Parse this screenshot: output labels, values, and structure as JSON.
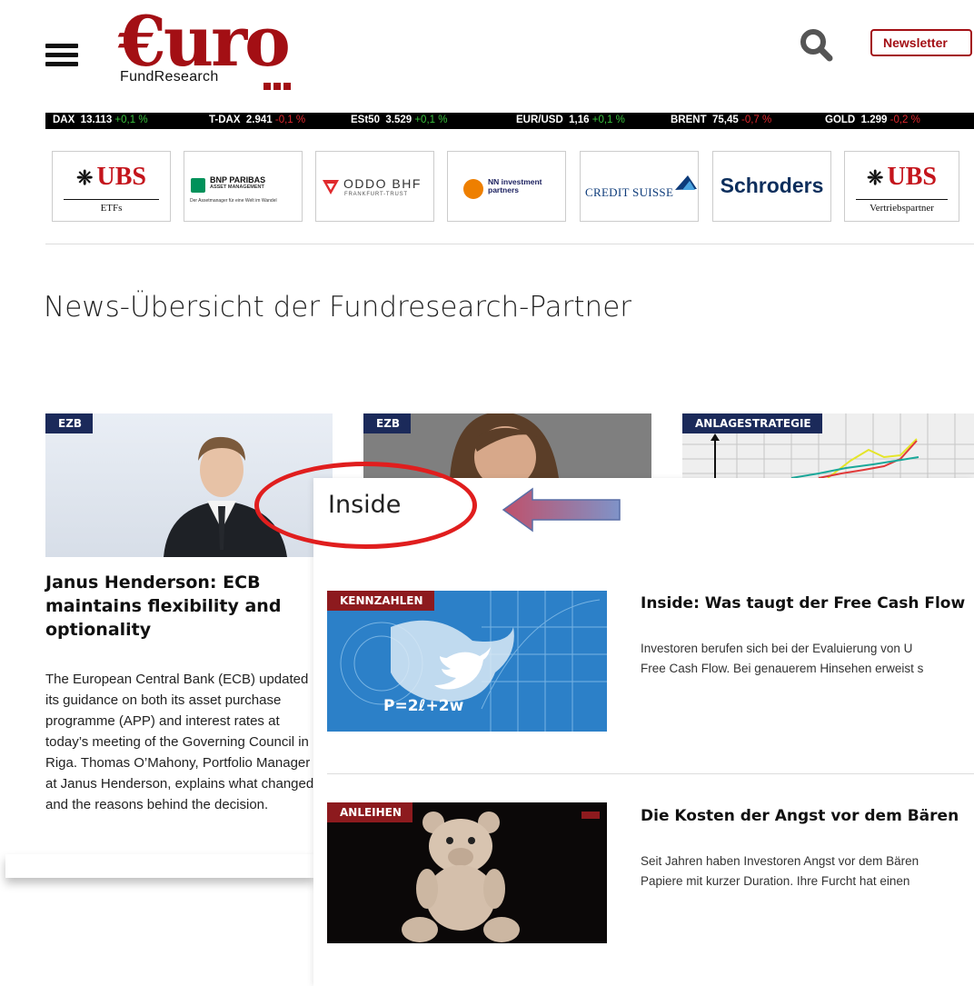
{
  "header": {
    "logo_text": "€uro",
    "logo_sub": "FundResearch",
    "newsletter_label": "Newsletter",
    "menu_icon": "hamburger-menu-icon",
    "search_icon": "search-icon"
  },
  "ticker": [
    {
      "name": "DAX",
      "value": "13.113",
      "change": "+0,1 %",
      "direction": "up"
    },
    {
      "name": "T-DAX",
      "value": "2.941",
      "change": "-0,1 %",
      "direction": "down"
    },
    {
      "name": "ESt50",
      "value": "3.529",
      "change": "+0,1 %",
      "direction": "up"
    },
    {
      "name": "EUR/USD",
      "value": "1,16",
      "change": "+0,1 %",
      "direction": "up"
    },
    {
      "name": "BRENT",
      "value": "75,45",
      "change": "-0,7 %",
      "direction": "down"
    },
    {
      "name": "GOLD",
      "value": "1.299",
      "change": "-0,2 %",
      "direction": "down"
    }
  ],
  "partners": [
    {
      "name": "UBS",
      "sub": "ETFs"
    },
    {
      "name": "BNP PARIBAS",
      "line2": "ASSET MANAGEMENT",
      "sub": "Der Assetmanager für eine Welt im Wandel"
    },
    {
      "name": "ODDO BHF",
      "sub": "FRANKFURT-TRUST"
    },
    {
      "name": "NN investment",
      "line2": "partners"
    },
    {
      "name": "CREDIT SUISSE"
    },
    {
      "name": "Schroders"
    },
    {
      "name": "UBS",
      "sub": "Vertriebspartner"
    }
  ],
  "page_title": "News-Übersicht der Fundresearch-Partner",
  "cards": [
    {
      "tag": "EZB"
    },
    {
      "tag": "EZB"
    },
    {
      "tag": "ANLAGESTRATEGIE"
    }
  ],
  "main_article": {
    "title": "Janus Henderson: ECB maintains flexibility and optionality",
    "text": "The European Central Bank (ECB) updated its guidance on both its asset purchase programme (APP) and interest rates at today’s meeting of the Governing Council in Riga. Thomas O’Mahony, Portfolio Manager at Janus Henderson, explains what changed and the reasons behind the decision."
  },
  "inside": {
    "title": "Inside",
    "articles": [
      {
        "tag": "KENNZAHLEN",
        "image_formula": "P=2ℓ+2w",
        "title": "Inside: Was taugt der Free Cash Flow",
        "lines": [
          "Investoren berufen sich bei der Evaluierung von U",
          "Free Cash Flow. Bei genauerem Hinsehen erweist s"
        ]
      },
      {
        "tag": "ANLEIHEN",
        "title": "Die Kosten der Angst vor dem Bären",
        "lines": [
          "Seit Jahren haben Investoren Angst vor dem Bären",
          "Papiere mit kurzer Duration. Ihre Furcht hat einen"
        ]
      }
    ]
  },
  "colors": {
    "brand_red": "#a30f14",
    "tag_blue": "#1b2a5a",
    "tag_red": "#8d1a1e",
    "ticker_up": "#38c13c",
    "ticker_down": "#e0272d",
    "annotation_red": "#e01e1e"
  }
}
